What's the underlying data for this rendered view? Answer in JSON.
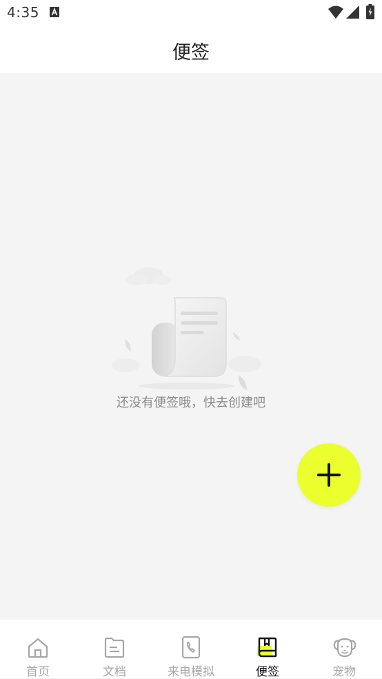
{
  "status_bar": {
    "time": "4:35",
    "icons": [
      "text-a-icon",
      "wifi-icon",
      "signal-icon",
      "battery-icon"
    ]
  },
  "header": {
    "title": "便签"
  },
  "empty_state": {
    "message": "还没有便签哦，快去创建吧",
    "icon": "document-illustration-icon"
  },
  "fab": {
    "icon": "plus-icon",
    "color": "#ebff2f"
  },
  "bottom_nav": {
    "active_index": 3,
    "active_color": "#111111",
    "inactive_color": "#a6a6a6",
    "accent_color": "#ebff2f",
    "items": [
      {
        "label": "首页",
        "icon": "home-icon"
      },
      {
        "label": "文档",
        "icon": "document-folder-icon"
      },
      {
        "label": "来电模拟",
        "icon": "phone-icon"
      },
      {
        "label": "便签",
        "icon": "notebook-icon"
      },
      {
        "label": "宠物",
        "icon": "pet-face-icon"
      }
    ]
  }
}
